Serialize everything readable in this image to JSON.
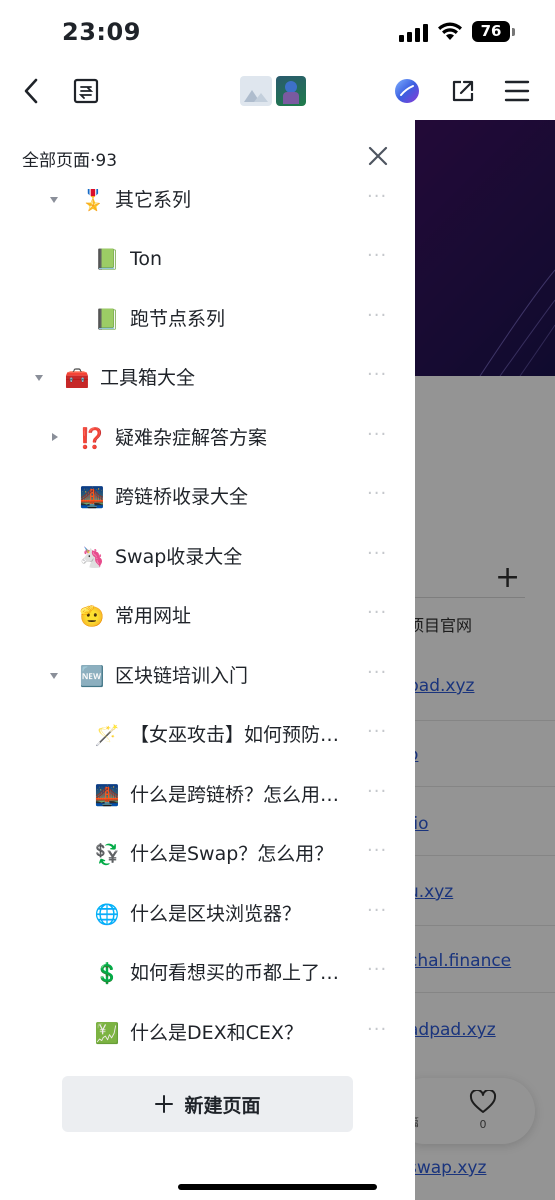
{
  "status_bar": {
    "time": "23:09",
    "battery": "76"
  },
  "drawer": {
    "title": "全部页面·93",
    "items": [
      {
        "icon": "🎖️",
        "label": "其它系列"
      },
      {
        "icon": "📗",
        "label": "Ton"
      },
      {
        "icon": "📗",
        "label": "跑节点系列"
      },
      {
        "icon": "🧰",
        "label": "工具箱大全"
      },
      {
        "icon": "⁉️",
        "label": "疑难杂症解答方案"
      },
      {
        "icon": "🌉",
        "label": "跨链桥收录大全"
      },
      {
        "icon": "🦄",
        "label": "Swap收录大全"
      },
      {
        "icon": "🫡",
        "label": "常用网址"
      },
      {
        "icon": "🆕",
        "label": "区块链培训入门"
      },
      {
        "icon": "🪄",
        "label": "【女巫攻击】如何预防…"
      },
      {
        "icon": "🌉",
        "label": "什么是跨链桥？怎么用…"
      },
      {
        "icon": "💱",
        "label": "什么是Swap？怎么用？"
      },
      {
        "icon": "🌐",
        "label": "什么是区块浏览器？"
      },
      {
        "icon": "💲",
        "label": "如何看想买的币都上了…"
      },
      {
        "icon": "💹",
        "label": "什么是DEX和CEX？"
      }
    ],
    "more_glyph": "···",
    "new_page_label": "新建页面"
  },
  "background_page": {
    "column_header": "项目官网",
    "links": [
      "pad.xyz",
      "o",
      ".io",
      "u.xyz",
      "chal.finance",
      "adpad.xyz",
      "swap.xyz"
    ],
    "like_count": "0",
    "partial_label": "篇"
  },
  "icons": {
    "back": "chevron-left-icon",
    "outline": "outline-icon",
    "avatar": "app-avatar-icon",
    "share": "share-icon",
    "menu": "hamburger-menu-icon",
    "close": "close-icon",
    "plus": "plus-icon",
    "heart": "heart-icon"
  }
}
